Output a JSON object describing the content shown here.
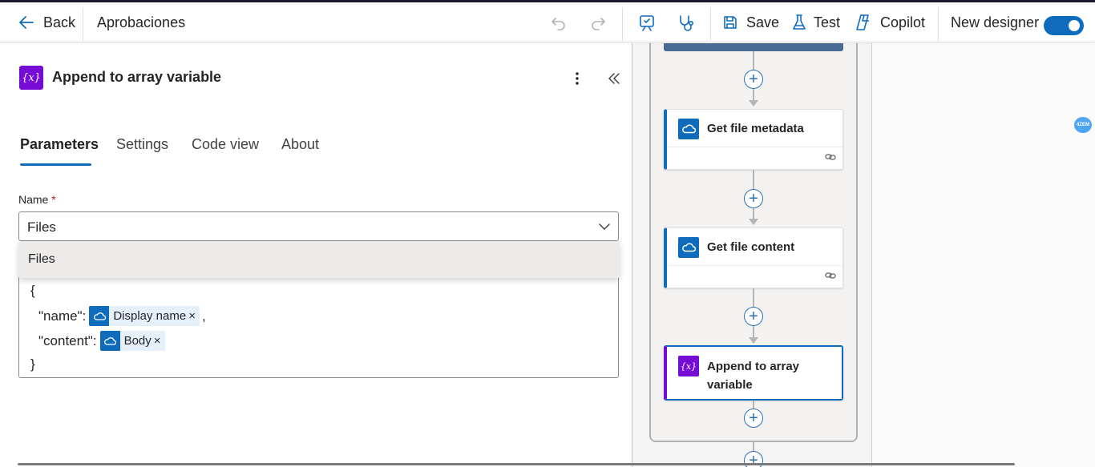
{
  "header": {
    "back_label": "Back",
    "flow_name": "Aprobaciones",
    "save_label": "Save",
    "test_label": "Test",
    "copilot_label": "Copilot",
    "new_designer_label": "New designer",
    "new_designer_on": true,
    "icons": [
      "back-arrow-icon",
      "undo-icon",
      "redo-icon",
      "flow-checker-icon",
      "stethoscope-icon",
      "save-icon",
      "flask-icon",
      "copilot-icon"
    ]
  },
  "panel": {
    "action_icon_text": "{x}",
    "title": "Append to array variable",
    "tabs": [
      {
        "label": "Parameters",
        "active": true
      },
      {
        "label": "Settings",
        "active": false
      },
      {
        "label": "Code view",
        "active": false
      },
      {
        "label": "About",
        "active": false
      }
    ],
    "name_label": "Name",
    "required_mark": "*",
    "name_value": "Files",
    "dropdown_options": [
      "Files"
    ],
    "value_lines": {
      "open": "{",
      "name_key": "\"name\":",
      "name_token": "Display name",
      "name_comma": ",",
      "content_key": "\"content\":",
      "content_token": "Body",
      "close": "}",
      "remove": "×"
    }
  },
  "canvas": {
    "cards": [
      {
        "title": "Get file metadata",
        "icon": "onedrive-icon"
      },
      {
        "title": "Get file content",
        "icon": "onedrive-icon"
      },
      {
        "title": "Append to array variable",
        "icon": "variable-icon",
        "selected": true
      }
    ],
    "add_icon": "+",
    "badge_text": "4ZEM"
  },
  "colors": {
    "accent": "#0f6cbd",
    "variable_purple": "#770bd6",
    "token_bg": "#e6f0fa"
  }
}
